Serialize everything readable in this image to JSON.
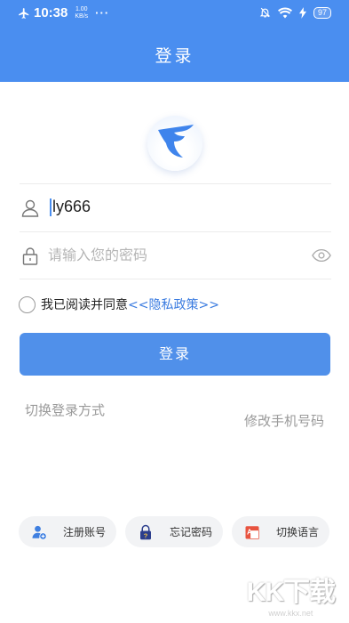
{
  "status_bar": {
    "time": "10:38",
    "net_speed_value": "1.00",
    "net_speed_unit": "KB/s",
    "dots": "···",
    "battery": "97"
  },
  "header": {
    "title": "登录"
  },
  "form": {
    "username_value": "ly666",
    "password_placeholder": "请输入您的密码"
  },
  "agreement": {
    "text": "我已阅读并同意",
    "policy_link": "<<隐私政策>>"
  },
  "login_button": "登录",
  "links": {
    "switch_login": "切换登录方式",
    "change_phone": "修改手机号码"
  },
  "bottom_actions": [
    {
      "label": "注册账号",
      "icon": "add-user-icon"
    },
    {
      "label": "忘记密码",
      "icon": "lock-question-icon"
    },
    {
      "label": "切换语言",
      "icon": "language-icon"
    }
  ],
  "watermark": {
    "text": "KK下载",
    "url": "www.kkx.net"
  },
  "colors": {
    "primary": "#4a8ef0",
    "button": "#5090ea",
    "link": "#3a7be0",
    "muted": "#9a9a9a"
  }
}
